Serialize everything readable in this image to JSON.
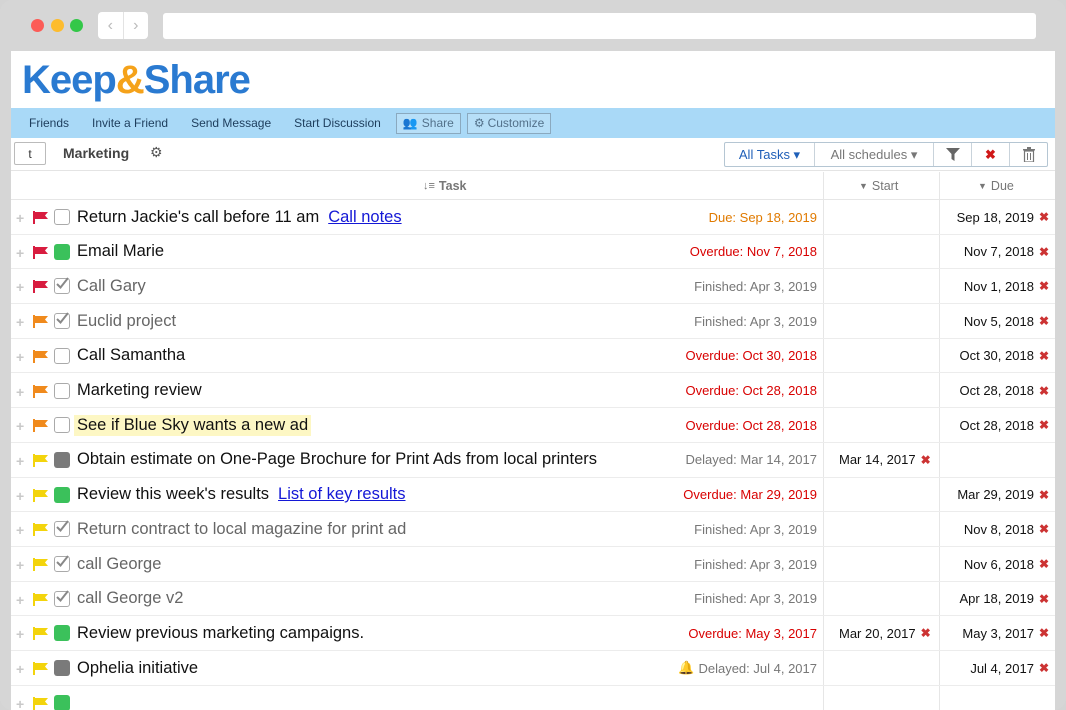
{
  "app": {
    "logo_a": "Keep",
    "logo_amp": "&",
    "logo_b": "Share"
  },
  "nav": {
    "links": [
      "Friends",
      "Invite a Friend",
      "Send Message",
      "Start Discussion"
    ],
    "share": "Share",
    "customize": "Customize"
  },
  "toolbar": {
    "t_button": "t",
    "schedule_name": "Marketing",
    "all_tasks": "All Tasks ▾",
    "all_schedules": "All schedules ▾"
  },
  "columns": {
    "task": "Task",
    "start": "Start",
    "due": "Due"
  },
  "colors": {
    "red_flag": "#d81c3f",
    "orange_flag": "#f08a1c",
    "yellow_flag": "#f3d40c",
    "green": "#3bc15b",
    "gray": "#7a7a7a",
    "overdue": "#d80000",
    "due": "#e07a00",
    "link": "#1418d6"
  },
  "tasks": [
    {
      "title": "Return Jackie's call before 11 am",
      "link": "Call notes",
      "flag": "red",
      "check": "empty",
      "status": "Due: Sep 18, 2019",
      "status_type": "due",
      "start": "",
      "due": "Sep 18, 2019"
    },
    {
      "title": "Email Marie",
      "link": "",
      "flag": "red",
      "check": "green",
      "status": "Overdue: Nov 7, 2018",
      "status_type": "overdue",
      "start": "",
      "due": "Nov 7, 2018"
    },
    {
      "title": "Call Gary",
      "link": "",
      "flag": "red",
      "check": "done",
      "status": "Finished: Apr 3, 2019",
      "status_type": "finished",
      "start": "",
      "due": "Nov 1, 2018"
    },
    {
      "title": "Euclid project",
      "link": "",
      "flag": "orange",
      "check": "done",
      "status": "Finished: Apr 3, 2019",
      "status_type": "finished",
      "start": "",
      "due": "Nov 5, 2018"
    },
    {
      "title": "Call Samantha",
      "link": "",
      "flag": "orange",
      "check": "empty",
      "status": "Overdue: Oct 30, 2018",
      "status_type": "overdue",
      "start": "",
      "due": "Oct 30, 2018"
    },
    {
      "title": "Marketing review",
      "link": "",
      "flag": "orange",
      "check": "empty",
      "status": "Overdue: Oct 28, 2018",
      "status_type": "overdue",
      "start": "",
      "due": "Oct 28, 2018"
    },
    {
      "title": "See if Blue Sky wants a new ad",
      "link": "",
      "flag": "orange",
      "check": "empty",
      "highlight": true,
      "status": "Overdue: Oct 28, 2018",
      "status_type": "overdue",
      "start": "",
      "due": "Oct 28, 2018"
    },
    {
      "title": "Obtain estimate on One-Page Brochure for Print Ads from local printers",
      "link": "",
      "flag": "yellow",
      "check": "gray",
      "status": "Delayed: Mar 14, 2017",
      "status_type": "finished",
      "start": "Mar 14, 2017",
      "due": ""
    },
    {
      "title": "Review this week's results",
      "link": "List of key results",
      "flag": "yellow",
      "check": "green",
      "status": "Overdue: Mar 29, 2019",
      "status_type": "overdue",
      "start": "",
      "due": "Mar 29, 2019"
    },
    {
      "title": "Return contract to local magazine for print ad",
      "link": "",
      "flag": "yellow",
      "check": "done",
      "status": "Finished: Apr 3, 2019",
      "status_type": "finished",
      "start": "",
      "due": "Nov 8, 2018"
    },
    {
      "title": "call George",
      "link": "",
      "flag": "yellow",
      "check": "done",
      "status": "Finished: Apr 3, 2019",
      "status_type": "finished",
      "start": "",
      "due": "Nov 6, 2018"
    },
    {
      "title": "call George v2",
      "link": "",
      "flag": "yellow",
      "check": "done",
      "status": "Finished: Apr 3, 2019",
      "status_type": "finished",
      "start": "",
      "due": "Apr 18, 2019"
    },
    {
      "title": "Review previous marketing campaigns.",
      "link": "",
      "flag": "yellow",
      "check": "green",
      "status": "Overdue: May 3, 2017",
      "status_type": "overdue",
      "start": "Mar 20, 2017",
      "due": "May 3, 2017"
    },
    {
      "title": "Ophelia initiative",
      "link": "",
      "flag": "yellow",
      "check": "gray",
      "bell": true,
      "status": "Delayed: Jul 4, 2017",
      "status_type": "finished",
      "start": "",
      "due": "Jul 4, 2017"
    },
    {
      "title": "",
      "link": "",
      "flag": "yellow",
      "check": "green",
      "status": "",
      "status_type": "overdue",
      "start": "",
      "due": ""
    }
  ]
}
